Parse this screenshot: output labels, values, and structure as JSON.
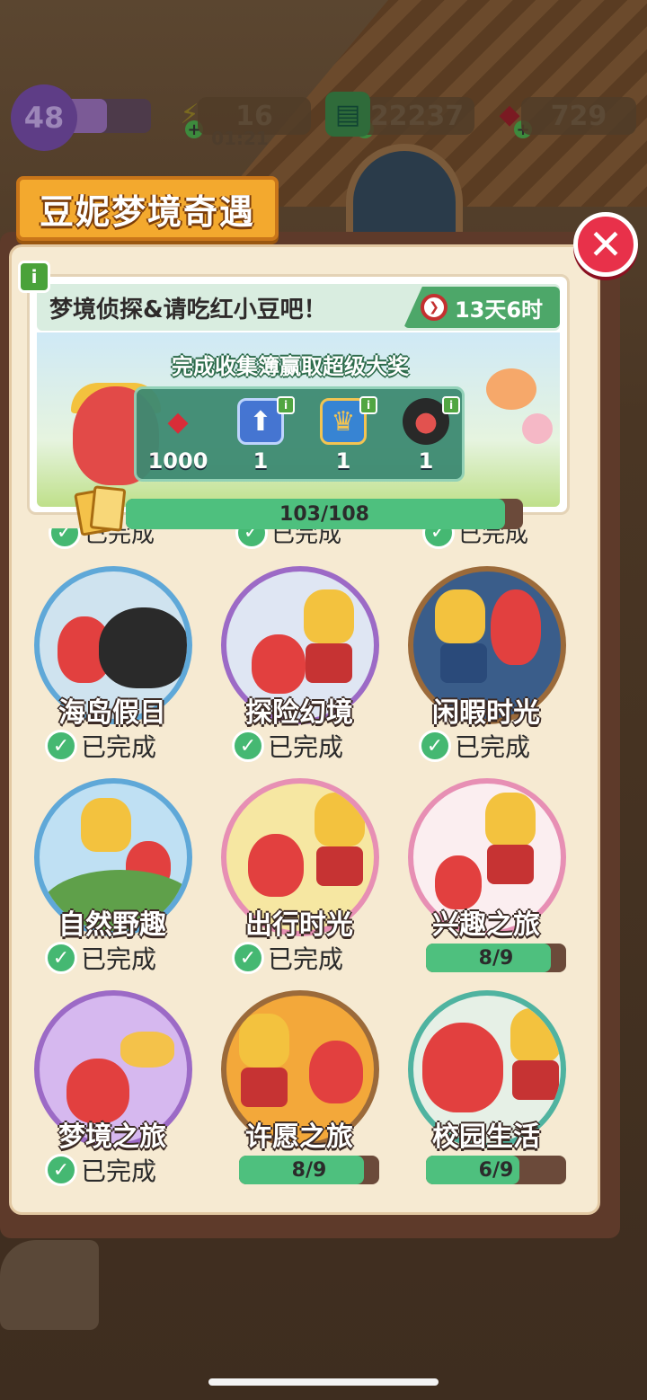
{
  "hud": {
    "level": "48",
    "level_fill": 0.5,
    "energy": "16",
    "energy_timer": "01:21",
    "cash": "22237",
    "gems": "729",
    "plus": "+"
  },
  "title": "豆妮梦境奇遇",
  "close_label": "✕",
  "info_label": "i",
  "banner": {
    "title": "梦境侦探&请吃红小豆吧！",
    "timer": "13天6时",
    "subtitle": "完成收集簿赢取超级大奖",
    "rewards": [
      {
        "icon": "ruby-gem-icon",
        "qty": "1000",
        "color": "#d8232f"
      },
      {
        "icon": "upgrade-card-icon",
        "qty": "1",
        "color": "#3d6fd1"
      },
      {
        "icon": "treasure-chest-icon",
        "qty": "1",
        "color": "#2e7fd3"
      },
      {
        "icon": "avatar-costume-icon",
        "qty": "1",
        "color": "#1f1f1f"
      }
    ]
  },
  "collection_progress": {
    "text": "103/108",
    "value": 103,
    "max": 108
  },
  "done_label": "已完成",
  "check_glyph": "✓",
  "albums": [
    {
      "name": "海岛假日",
      "status": "done"
    },
    {
      "name": "探险幻境",
      "status": "done"
    },
    {
      "name": "闲暇时光",
      "status": "done"
    },
    {
      "name": "自然野趣",
      "status": "done"
    },
    {
      "name": "出行时光",
      "status": "done"
    },
    {
      "name": "兴趣之旅",
      "status": "progress",
      "progress": "8/9",
      "value": 8,
      "max": 9
    },
    {
      "name": "梦境之旅",
      "status": "done"
    },
    {
      "name": "许愿之旅",
      "status": "progress",
      "progress": "8/9",
      "value": 8,
      "max": 9
    },
    {
      "name": "校园生活",
      "status": "progress",
      "progress": "6/9",
      "value": 6,
      "max": 9
    }
  ]
}
